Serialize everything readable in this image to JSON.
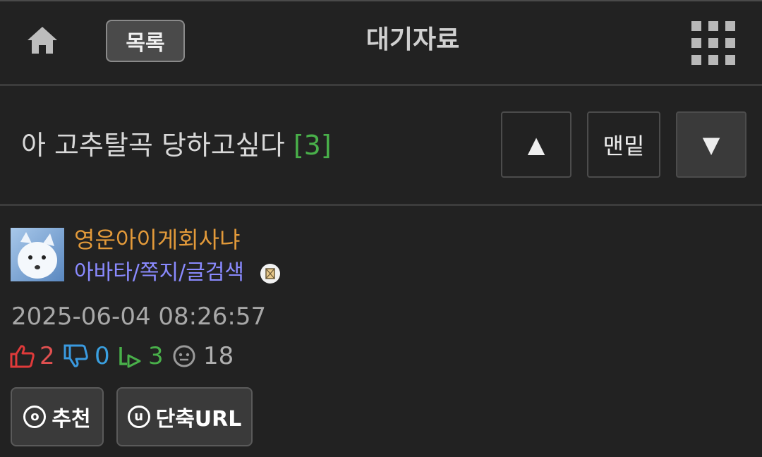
{
  "header": {
    "home_icon": "home-icon",
    "list_button": "목록",
    "board_title": "대기자료",
    "menu_icon": "grid-menu-icon"
  },
  "post": {
    "title": "아 고추탈곡 당하고싶다",
    "comment_count": "[3]",
    "nav": {
      "up_icon": "▲",
      "bottom_label": "맨밑",
      "down_icon": "▼"
    },
    "author": {
      "name": "영운아이게회사냐",
      "links": "아바타/쪽지/글검색",
      "avatar_icon": "avatar-image",
      "badge_icon": "mail-badge-icon"
    },
    "timestamp": "2025-06-04 08:26:57",
    "stats": {
      "likes": "2",
      "dislikes": "0",
      "comments": "3",
      "views": "18"
    },
    "actions": {
      "recommend_icon": "o",
      "recommend_label": "추천",
      "shorturl_icon": "u",
      "shorturl_label": "단축URL"
    }
  },
  "colors": {
    "background": "#222222",
    "author": "#e39a3a",
    "links": "#8a8aff",
    "comment_count": "#49b04a",
    "like": "#e03a3a",
    "dislike": "#3a9ae0",
    "reply": "#49b04a"
  }
}
